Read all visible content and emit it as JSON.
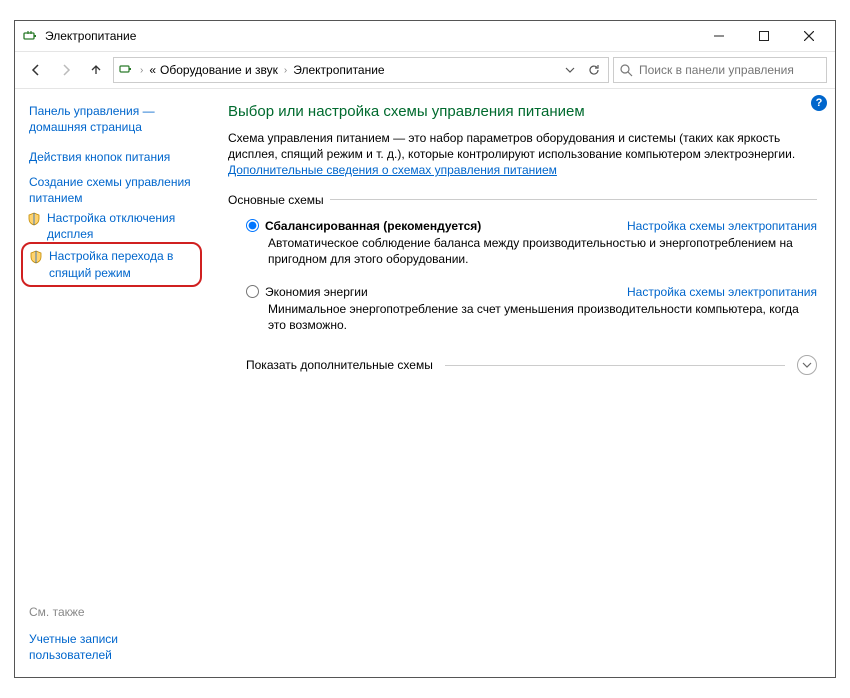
{
  "window": {
    "title": "Электропитание"
  },
  "breadcrumbs": {
    "root": "«",
    "path1": "Оборудование и звук",
    "path2": "Электропитание"
  },
  "search": {
    "placeholder": "Поиск в панели управления"
  },
  "sidebar": {
    "home": "Панель управления — домашняя страница",
    "links": {
      "power_buttons": "Действия кнопок питания",
      "create_plan": "Создание схемы управления питанием",
      "display_off": "Настройка отключения дисплея",
      "sleep": "Настройка перехода в спящий режим"
    },
    "see_also": "См. также",
    "user_accounts": "Учетные записи пользователей"
  },
  "main": {
    "title": "Выбор или настройка схемы управления питанием",
    "desc_part1": "Схема управления питанием — это набор параметров оборудования и системы (таких как яркость дисплея, спящий режим и т. д.), которые контролируют использование компьютером электроэнергии. ",
    "desc_link": "Дополнительные сведения о схемах управления питанием",
    "section_main": "Основные схемы",
    "plans": {
      "balanced": {
        "label": "Сбалансированная (рекомендуется)",
        "desc": "Автоматическое соблюдение баланса между производительностью и энергопотреблением на пригодном для этого оборудовании.",
        "settings": "Настройка схемы электропитания"
      },
      "saver": {
        "label": "Экономия энергии",
        "desc": "Минимальное энергопотребление за счет уменьшения производительности компьютера, когда это возможно.",
        "settings": "Настройка схемы электропитания"
      }
    },
    "expand": "Показать дополнительные схемы"
  }
}
